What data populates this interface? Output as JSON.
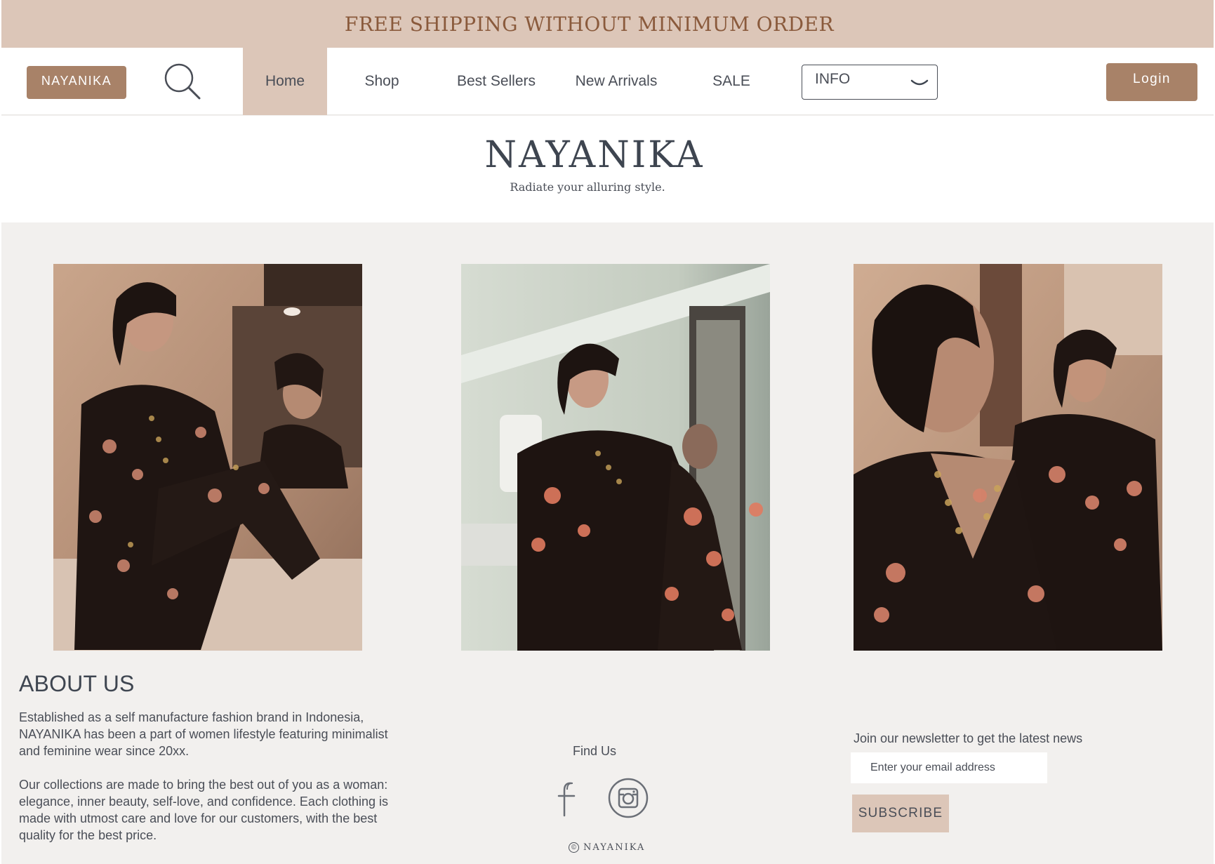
{
  "announcement": {
    "text": "FREE SHIPPING WITHOUT MINIMUM ORDER"
  },
  "nav": {
    "brand_label": "NAYANIKA",
    "search_icon": "search-icon",
    "items": [
      {
        "label": "Home",
        "active": true
      },
      {
        "label": "Shop"
      },
      {
        "label": "Best Sellers"
      },
      {
        "label": "New Arrivals"
      },
      {
        "label": "SALE"
      }
    ],
    "info_select": {
      "label": "INFO",
      "icon": "chevron-down-icon"
    },
    "login_label": "Login"
  },
  "hero": {
    "title": "NAYANIKA",
    "tagline": "Radiate your alluring style."
  },
  "gallery": {
    "photos": [
      {
        "alt": "Model in black floral kurta posing by mirror"
      },
      {
        "alt": "Model in black floral kurta seated by wall"
      },
      {
        "alt": "Model in black floral kurta reflected in mirror"
      }
    ]
  },
  "about": {
    "title": "ABOUT US",
    "paragraphs": [
      "Established as a self manufacture fashion brand in Indonesia, NAYANIKA has been a part of women lifestyle featuring minimalist and feminine wear since 20xx.",
      "Our collections are made to bring the best out of you as a woman: elegance, inner beauty, self-love, and confidence. Each clothing is made with utmost care and love for our customers, with the best quality for the best price."
    ]
  },
  "social": {
    "label": "Find Us",
    "icons": [
      "facebook-icon",
      "instagram-icon"
    ]
  },
  "footer": {
    "copyright_symbol": "©",
    "brand": "NAYANIKA"
  },
  "newsletter": {
    "label": "Join our newsletter to get the latest news",
    "email_placeholder": "Enter your email address",
    "button_label": "SUBSCRIBE"
  },
  "colors": {
    "accent": "#a88268",
    "accent_light": "#dcc6b8",
    "announce_text": "#8a5a3c",
    "page_bg": "#f2f0ee",
    "text": "#4a4e57"
  }
}
